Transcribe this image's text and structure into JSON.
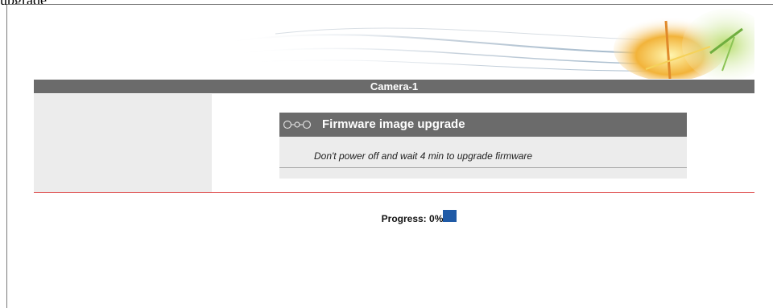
{
  "page": {
    "heading": "upgrade"
  },
  "header": {
    "title": "Camera-1"
  },
  "firmware": {
    "title": "Firmware image upgrade",
    "message": "Don't power off and wait 4 min to upgrade firmware",
    "icon": "link-chain-icon"
  },
  "progress": {
    "label": "Progress:",
    "value": "0%",
    "fraction": 0
  },
  "colors": {
    "bar_gray": "#6b6b6b",
    "panel_gray": "#ececec",
    "divider_red": "#e05555",
    "progress_blue": "#1f5aa6"
  }
}
